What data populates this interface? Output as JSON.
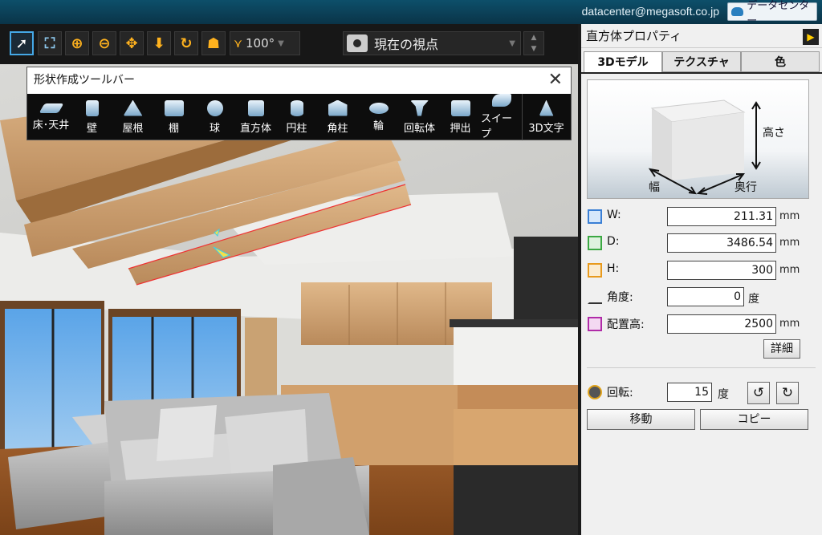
{
  "topbar": {
    "email": "datacenter@megasoft.co.jp",
    "datacenter_label": "データセンター"
  },
  "toolbar": {
    "icons": [
      "select-arrow-icon",
      "fit-view-icon",
      "zoom-in-icon",
      "zoom-out-icon",
      "pan-icon",
      "move-down-icon",
      "orbit-icon",
      "walk-icon",
      "fov-icon"
    ],
    "fov_value": "100°",
    "viewpoint": "現在の視点"
  },
  "shape_toolbar": {
    "title": "形状作成ツールバー",
    "items": [
      "床･天井",
      "壁",
      "屋根",
      "棚",
      "球",
      "直方体",
      "円柱",
      "角柱",
      "輪",
      "回転体",
      "押出",
      "スイープ",
      "3D文字"
    ]
  },
  "panel": {
    "title": "直方体プロパティ",
    "tabs": [
      "3Dモデル",
      "テクスチャ",
      "色"
    ],
    "preview": {
      "height": "高さ",
      "width": "幅",
      "depth": "奥行"
    },
    "props": [
      {
        "label": "W:",
        "value": "211.31",
        "unit": "mm"
      },
      {
        "label": "D:",
        "value": "3486.54",
        "unit": "mm"
      },
      {
        "label": "H:",
        "value": "300",
        "unit": "mm"
      },
      {
        "label": "角度:",
        "value": "0",
        "unit": "度"
      },
      {
        "label": "配置高:",
        "value": "2500",
        "unit": "mm"
      }
    ],
    "detail_label": "詳細",
    "rotation": {
      "label": "回転:",
      "value": "15",
      "unit": "度"
    },
    "move_label": "移動",
    "copy_label": "コピー"
  }
}
